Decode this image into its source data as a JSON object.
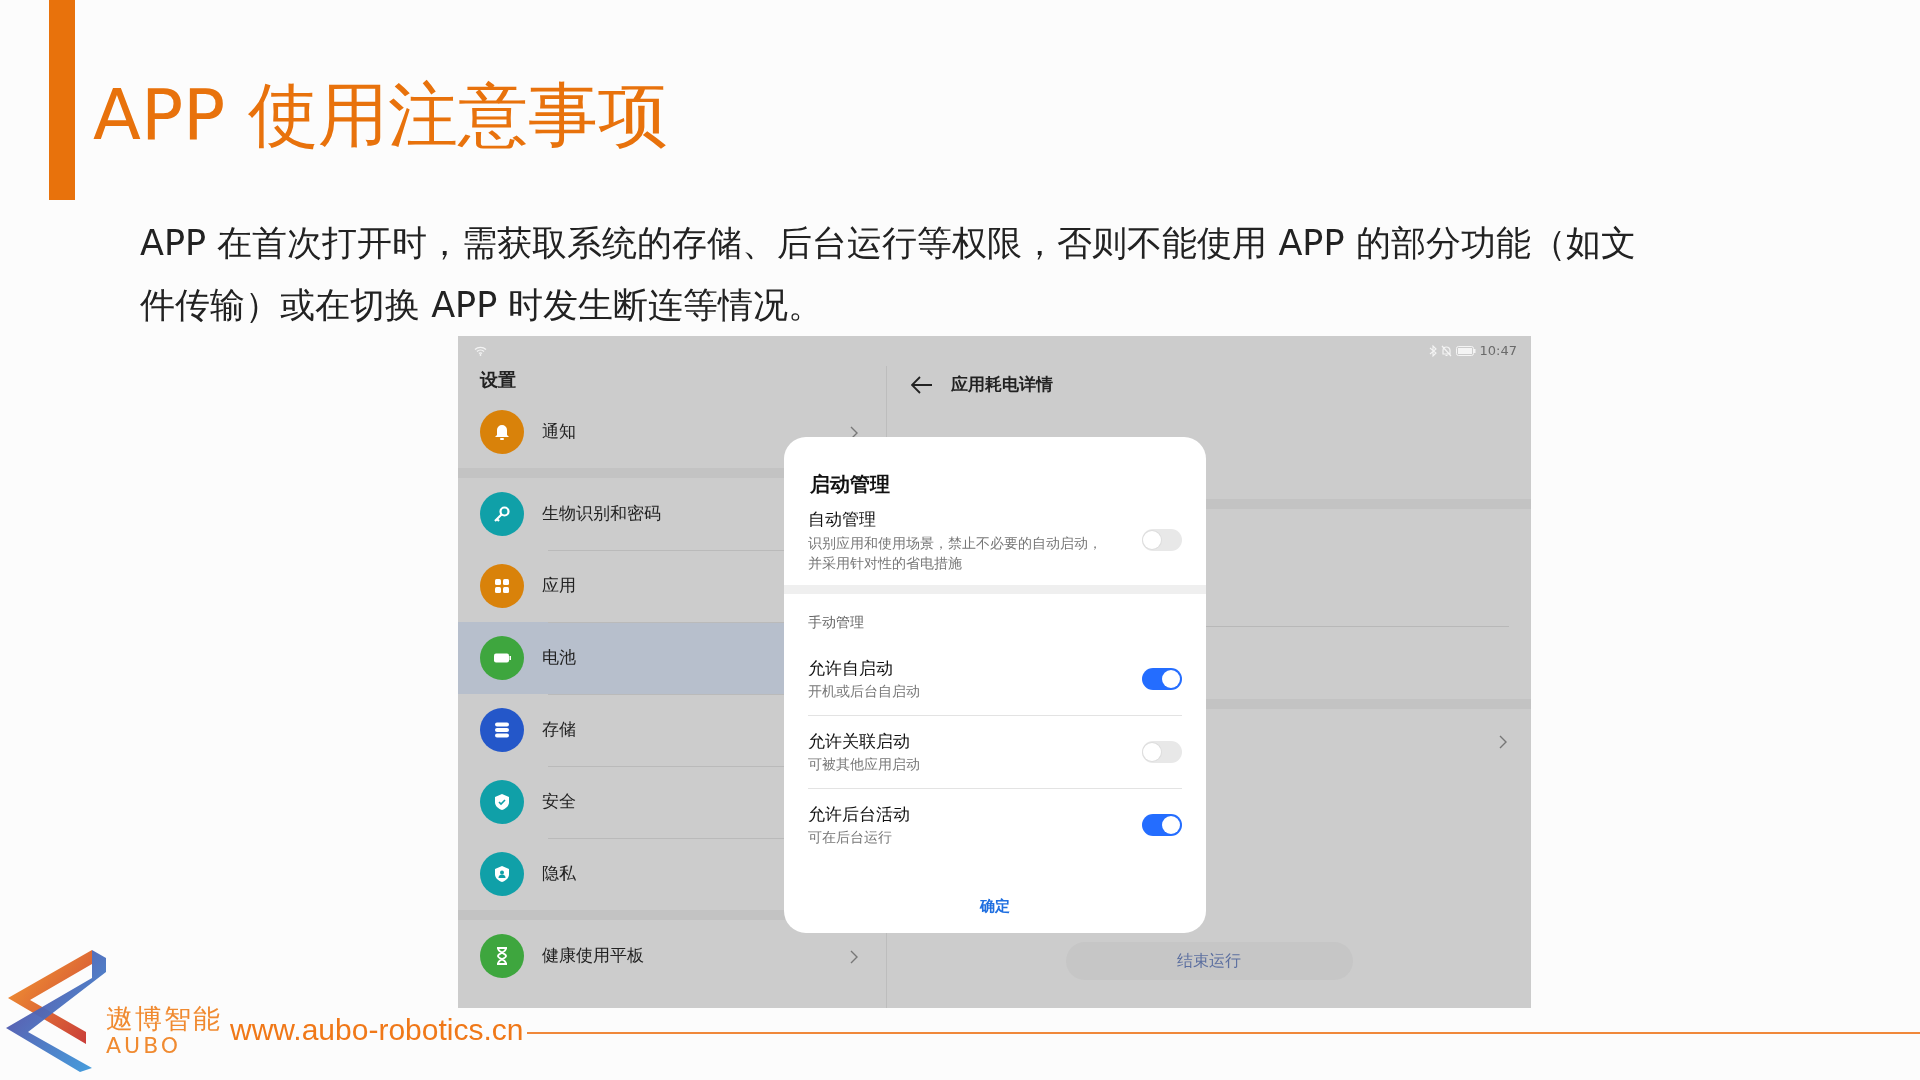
{
  "slide": {
    "title": "APP 使用注意事项",
    "body": "APP 在首次打开时，需获取系统的存储、后台运行等权限，否则不能使用 APP 的部分功能（如文件传输）或在切换 APP 时发生断连等情况。"
  },
  "screenshot": {
    "status_bar": {
      "time": "10:47"
    },
    "sidebar": {
      "title": "设置",
      "groups": [
        {
          "items": [
            {
              "label": "通知",
              "color": "#d9820a",
              "selected": false
            }
          ]
        },
        {
          "items": [
            {
              "label": "生物识别和密码",
              "color": "#10a0a8",
              "selected": false
            },
            {
              "label": "应用",
              "color": "#d9820a",
              "selected": false
            },
            {
              "label": "电池",
              "color": "#3ea63e",
              "selected": true
            },
            {
              "label": "存储",
              "color": "#2457c9",
              "selected": false
            },
            {
              "label": "安全",
              "color": "#10a0a8",
              "selected": false
            },
            {
              "label": "隐私",
              "color": "#10a0a8",
              "selected": false
            }
          ]
        },
        {
          "items": [
            {
              "label": "健康使用平板",
              "color": "#3ea63e",
              "selected": false
            }
          ]
        }
      ]
    },
    "detail": {
      "title": "应用耗电详情",
      "button": "结束运行"
    },
    "dialog": {
      "title": "启动管理",
      "auto": {
        "label": "自动管理",
        "description": "识别应用和使用场景，禁止不必要的自动启动，并采用针对性的省电措施",
        "on": false
      },
      "section": "手动管理",
      "options": [
        {
          "label": "允许自启动",
          "description": "开机或后台自启动",
          "on": true
        },
        {
          "label": "允许关联启动",
          "description": "可被其他应用启动",
          "on": false
        },
        {
          "label": "允许后台活动",
          "description": "可在后台运行",
          "on": true
        }
      ],
      "confirm": "确定"
    }
  },
  "footer": {
    "brand_cn": "遨博智能",
    "brand_en": "AUBO",
    "url": "www.aubo-robotics.cn"
  }
}
